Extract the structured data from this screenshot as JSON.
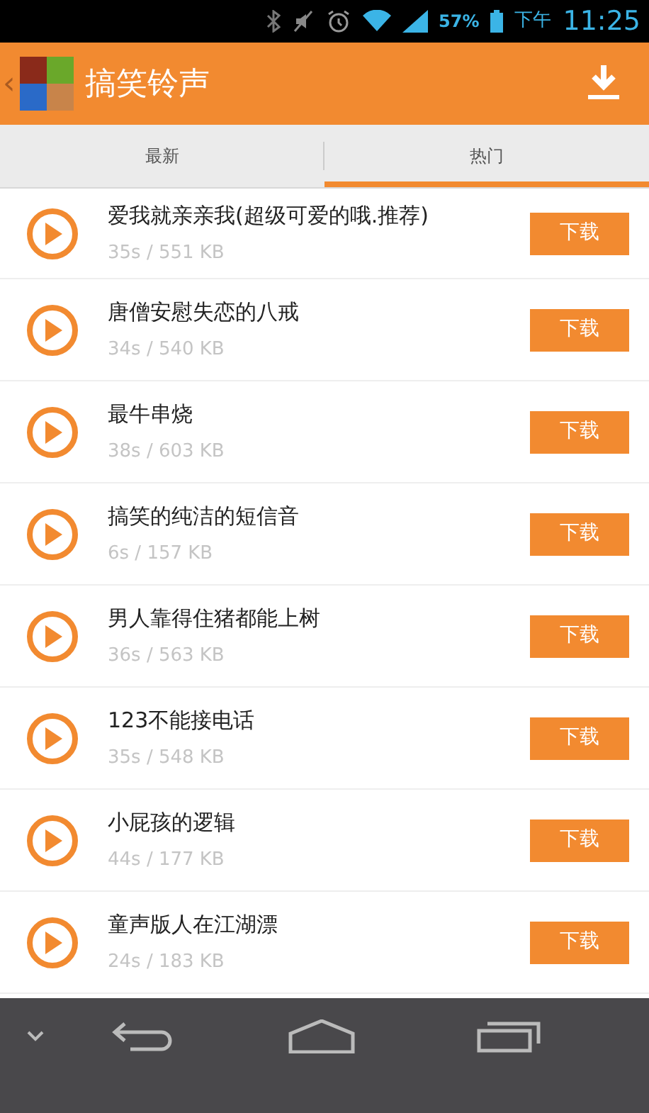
{
  "status_bar": {
    "battery": "57%",
    "period": "下午",
    "time": "11:25"
  },
  "app_bar": {
    "back": "‹",
    "title": "搞笑铃声"
  },
  "tabs": [
    {
      "label": "最新",
      "selected": false
    },
    {
      "label": "热门",
      "selected": true
    }
  ],
  "ringtones": [
    {
      "title": "爱我就亲亲我(超级可爱的哦.推荐)",
      "info": "35s / 551 KB",
      "action": "下载"
    },
    {
      "title": "唐僧安慰失恋的八戒",
      "info": "34s / 540 KB",
      "action": "下载"
    },
    {
      "title": "最牛串烧",
      "info": "38s / 603 KB",
      "action": "下载"
    },
    {
      "title": "搞笑的纯洁的短信音",
      "info": "6s / 157 KB",
      "action": "下载"
    },
    {
      "title": "男人靠得住猪都能上树",
      "info": "36s / 563 KB",
      "action": "下载"
    },
    {
      "title": "123不能接电话",
      "info": "35s / 548 KB",
      "action": "下载"
    },
    {
      "title": "小屁孩的逻辑",
      "info": "44s / 177 KB",
      "action": "下载"
    },
    {
      "title": "童声版人在江湖漂",
      "info": "24s / 183 KB",
      "action": "下载"
    }
  ]
}
